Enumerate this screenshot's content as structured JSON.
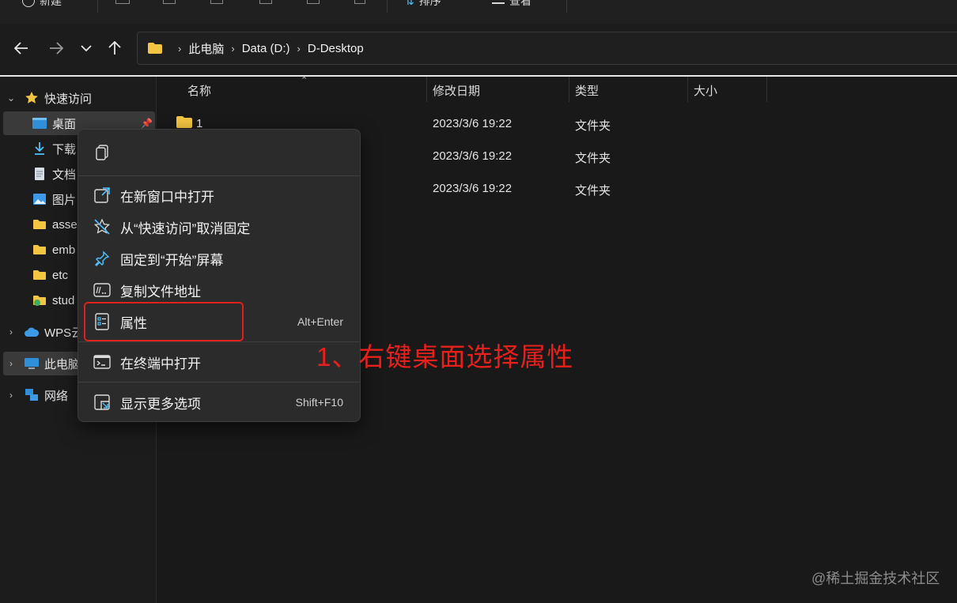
{
  "toolbar": {
    "new_label": "新建",
    "sort_label": "排序",
    "view_label": "查看"
  },
  "address": {
    "crumbs": [
      "此电脑",
      "Data (D:)",
      "D-Desktop"
    ]
  },
  "sidebar": {
    "quick_access": "快速访问",
    "items": [
      "桌面",
      "下载",
      "文档",
      "图片",
      "asse",
      "emb",
      "etc",
      "stud"
    ],
    "wps": "WPS云",
    "this_pc": "此电脑",
    "network": "网络"
  },
  "columns": {
    "name": "名称",
    "modified": "修改日期",
    "type": "类型",
    "size": "大小"
  },
  "files": [
    {
      "name": "1",
      "modified": "2023/3/6 19:22",
      "type": "文件夹"
    },
    {
      "name": "",
      "modified": "2023/3/6 19:22",
      "type": "文件夹"
    },
    {
      "name": "",
      "modified": "2023/3/6 19:22",
      "type": "文件夹"
    }
  ],
  "menu": {
    "open_new_window": "在新窗口中打开",
    "unpin_quick": "从“快速访问”取消固定",
    "pin_start": "固定到“开始”屏幕",
    "copy_path": "复制文件地址",
    "properties": "属性",
    "properties_key": "Alt+Enter",
    "open_terminal": "在终端中打开",
    "more_options": "显示更多选项",
    "more_options_key": "Shift+F10"
  },
  "annotation": "1、右键桌面选择属性",
  "watermark": "@稀土掘金技术社区",
  "colors": {
    "accent": "#4cc2ff",
    "annotation": "#e8201c",
    "folder": "#f4c542"
  }
}
